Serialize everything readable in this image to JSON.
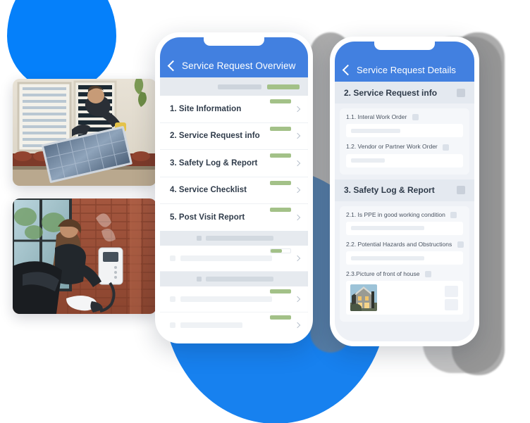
{
  "theme": {
    "header_blue": "#4280e0",
    "accent_blue": "#0580fa",
    "blob_blue": "#1781ef",
    "progress_green": "#a3c188",
    "text_dark": "#2f3b4a",
    "panel_gray": "#e6eaef",
    "card_gray": "#f5f7fa"
  },
  "phone_overview": {
    "nav": {
      "back_icon": "chevron-left-icon",
      "title": "Service Request Overview"
    },
    "sections": [
      {
        "label": "1. Site Information",
        "chevron": "chevron-right-icon",
        "progress": 100
      },
      {
        "label": "2. Service Request info",
        "chevron": "chevron-right-icon",
        "progress": 100
      },
      {
        "label": "3. Safety Log & Report",
        "chevron": "chevron-right-icon",
        "progress": 100
      },
      {
        "label": "4. Service Checklist",
        "chevron": "chevron-right-icon",
        "progress": 100
      },
      {
        "label": "5. Post Visit Report",
        "chevron": "chevron-right-icon",
        "progress": 100
      }
    ],
    "skeleton_groups": [
      {
        "type": "group-header"
      },
      {
        "type": "row",
        "progress": 45
      },
      {
        "type": "group-header"
      },
      {
        "type": "row",
        "progress": 100
      },
      {
        "type": "row",
        "progress": 100
      }
    ]
  },
  "phone_details": {
    "nav": {
      "back_icon": "chevron-left-icon",
      "title": "Service Request Details"
    },
    "sections": [
      {
        "title": "2. Service Request info",
        "checkbox_icon": "checkbox-icon",
        "fields": [
          {
            "label": "1.1. Interal Work Order",
            "checkbox_icon": "checkbox-icon",
            "value_width": 56
          },
          {
            "label": "1.2. Vendor or Partner Work Order",
            "checkbox_icon": "checkbox-icon",
            "value_width": 38
          }
        ]
      },
      {
        "title": "3. Safety Log & Report",
        "checkbox_icon": "checkbox-icon",
        "fields": [
          {
            "label": "2.1. Is PPE in good working condition",
            "checkbox_icon": "checkbox-icon",
            "value_width": 82
          },
          {
            "label": "2.2. Potential Hazards and Obstructions",
            "checkbox_icon": "checkbox-icon",
            "value_width": 82
          },
          {
            "label": "2.3.Picture of front of house",
            "checkbox_icon": "checkbox-icon",
            "type": "photo",
            "thumbnail_name": "house-front-thumbnail",
            "buttons": [
              "photo-action-button-1",
              "photo-action-button-2"
            ]
          }
        ]
      }
    ]
  },
  "photos": [
    {
      "name": "solar-panel-installation-photo",
      "alt": "Technician installing a solar panel on a tile roof beside a window"
    },
    {
      "name": "ev-charger-photo",
      "alt": "Person plugging an EV charger mounted on a brick wall"
    }
  ]
}
